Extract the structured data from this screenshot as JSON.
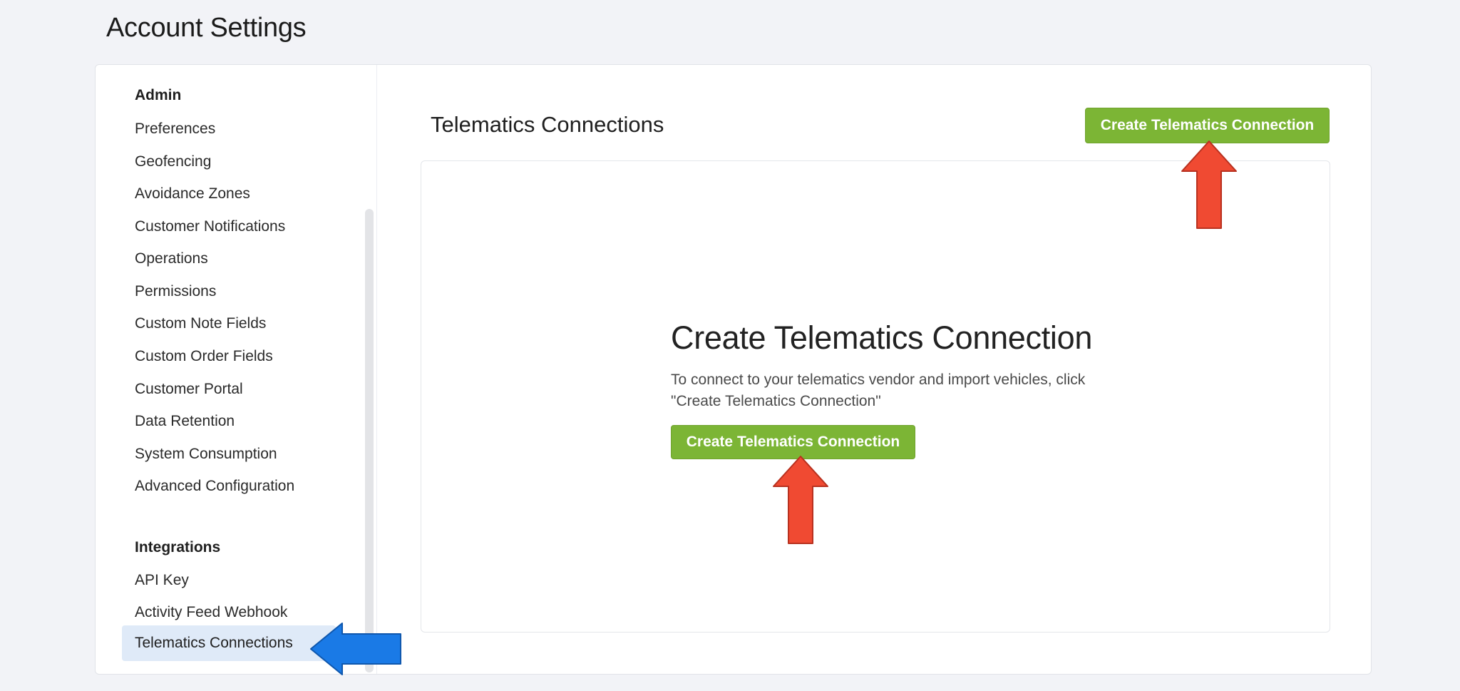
{
  "page": {
    "title": "Account Settings"
  },
  "sidebar": {
    "admin_heading": "Admin",
    "admin_items": [
      "Preferences",
      "Geofencing",
      "Avoidance Zones",
      "Customer Notifications",
      "Operations",
      "Permissions",
      "Custom Note Fields",
      "Custom Order Fields",
      "Customer Portal",
      "Data Retention",
      "System Consumption",
      "Advanced Configuration"
    ],
    "integrations_heading": "Integrations",
    "integrations_items": [
      "API Key",
      "Activity Feed Webhook",
      "Telematics Connections"
    ],
    "active_item": "Telematics Connections"
  },
  "main": {
    "title": "Telematics Connections",
    "create_button_label": "Create Telematics Connection",
    "empty_state": {
      "title": "Create Telematics Connection",
      "description": "To connect to your telematics vendor and import vehicles, click \"Create Telematics Connection\"",
      "button_label": "Create Telematics Connection"
    }
  },
  "colors": {
    "accent_green": "#7cb535",
    "active_nav_bg": "#dfeaf8",
    "annotation_red": "#f04a32",
    "annotation_blue": "#1a7ae6"
  },
  "icons": {
    "annotation_arrows": [
      "up-arrow-icon",
      "up-arrow-icon",
      "left-arrow-icon"
    ]
  }
}
